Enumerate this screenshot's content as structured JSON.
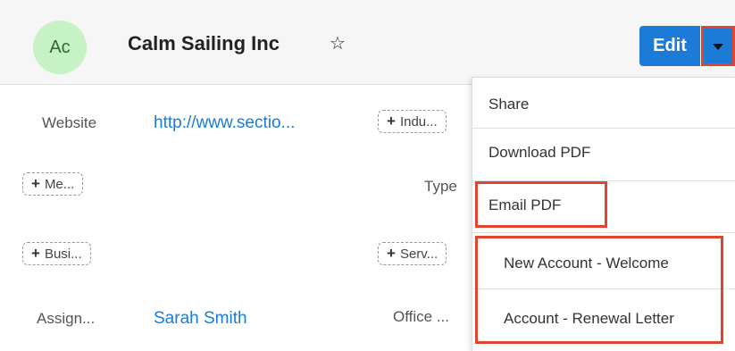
{
  "header": {
    "avatar_initials": "Ac",
    "record_name": "Calm Sailing Inc",
    "favorite_icon": "☆",
    "edit_label": "Edit"
  },
  "fields": {
    "website_label": "Website",
    "website_value": "http://www.sectio...",
    "industry_pill": "Indu...",
    "member_of_pill": "Me...",
    "type_label": "Type",
    "business_pill": "Busi...",
    "service_pill": "Serv...",
    "assigned_label": "Assign...",
    "assigned_value": "Sarah Smith",
    "office_label": "Office ..."
  },
  "menu": {
    "items": [
      {
        "label": "Share"
      },
      {
        "label": "Download PDF"
      },
      {
        "label": "Email PDF"
      },
      {
        "label": "New Account - Welcome"
      },
      {
        "label": "Account - Renewal Letter"
      }
    ]
  },
  "colors": {
    "primary": "#1b7bd7",
    "highlight": "#e0432e",
    "avatar_bg": "#c6f2c6"
  }
}
